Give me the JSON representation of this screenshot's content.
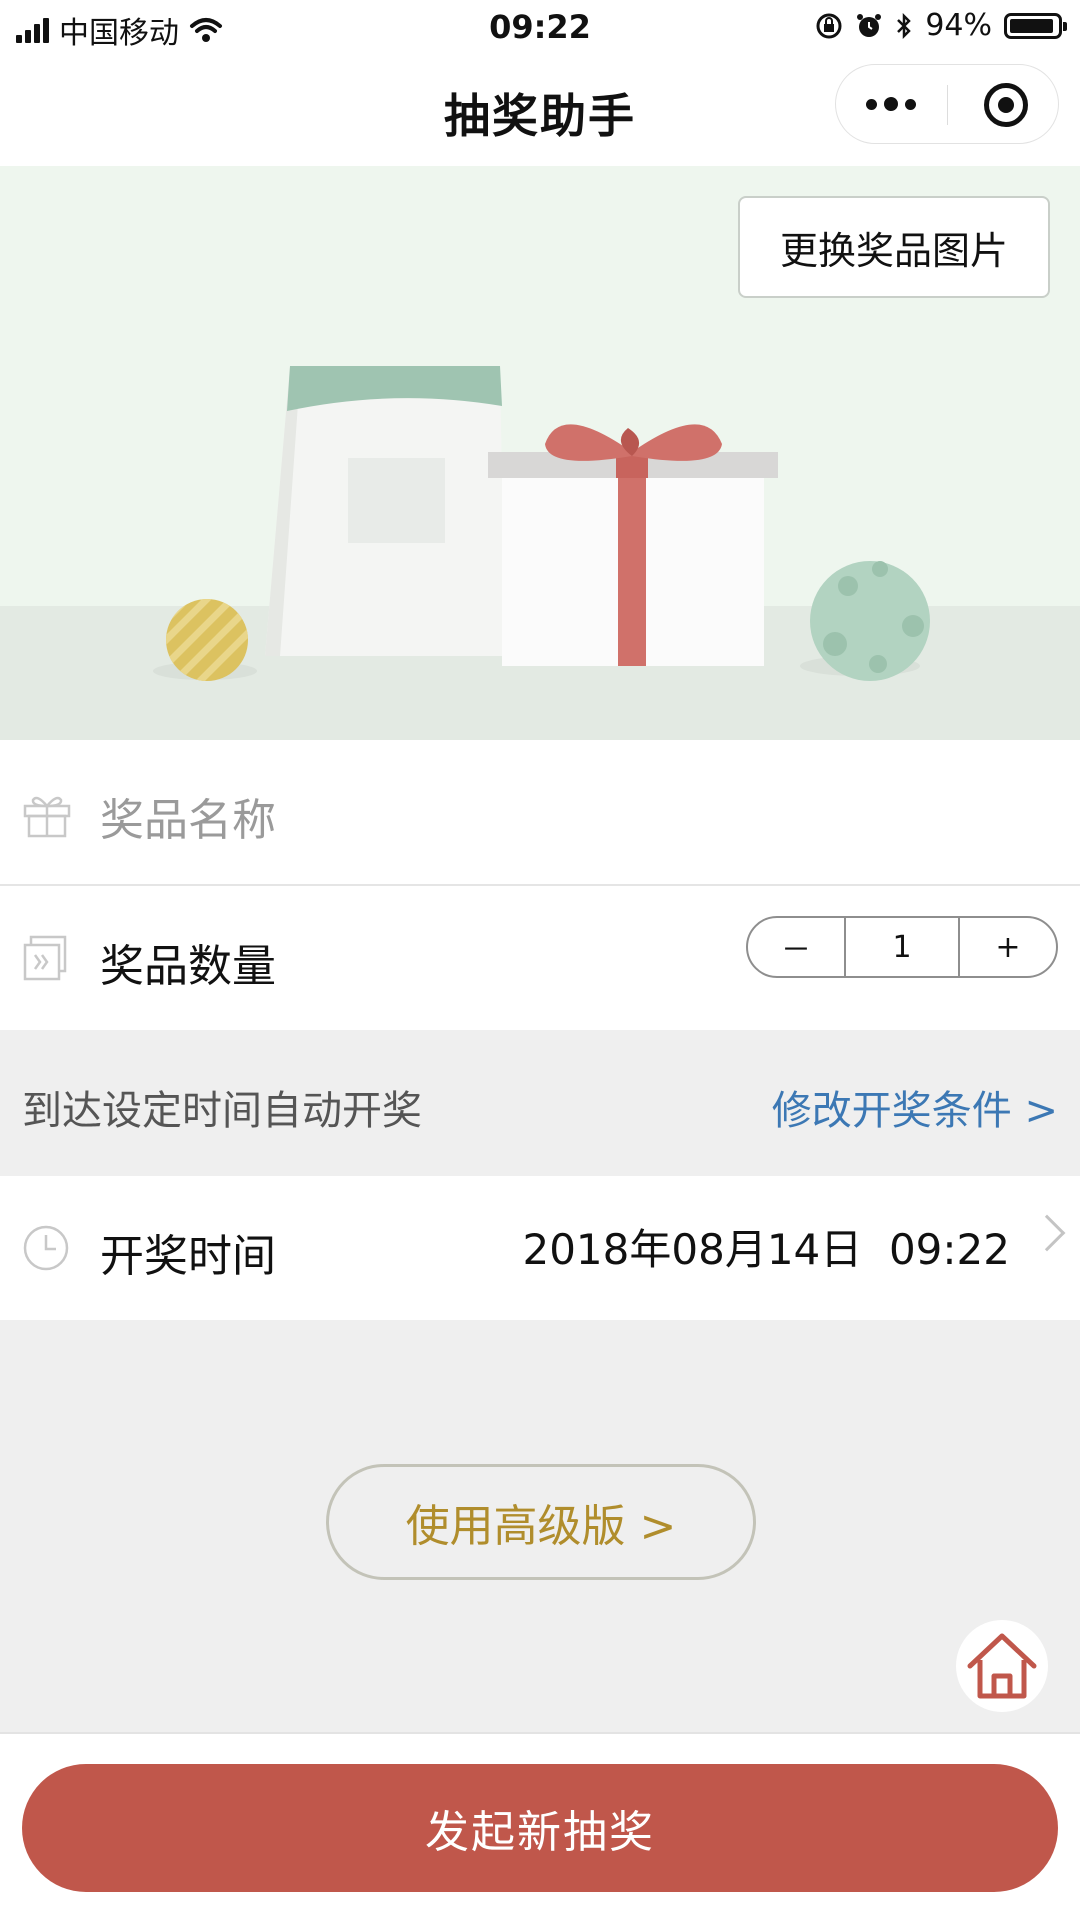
{
  "status_bar": {
    "carrier": "中国移动",
    "time": "09:22",
    "battery": "94%",
    "battery_level": 0.94
  },
  "nav": {
    "title": "抽奖助手"
  },
  "banner": {
    "change_image_label": "更换奖品图片"
  },
  "form": {
    "prize_name_placeholder": "奖品名称",
    "prize_count_label": "奖品数量",
    "prize_count_minus": "－",
    "prize_count_value": "1",
    "prize_count_plus": "+",
    "condition_text": "到达设定时间自动开奖",
    "condition_link": "修改开奖条件 >",
    "draw_time_label": "开奖时间",
    "draw_time_value": "2018年08月14日  09:22"
  },
  "advanced_label": "使用高级版 >",
  "submit_label": "发起新抽奖",
  "colors": {
    "accent": "#c0574b",
    "link": "#3c78b4",
    "gold": "#b08d2c"
  }
}
